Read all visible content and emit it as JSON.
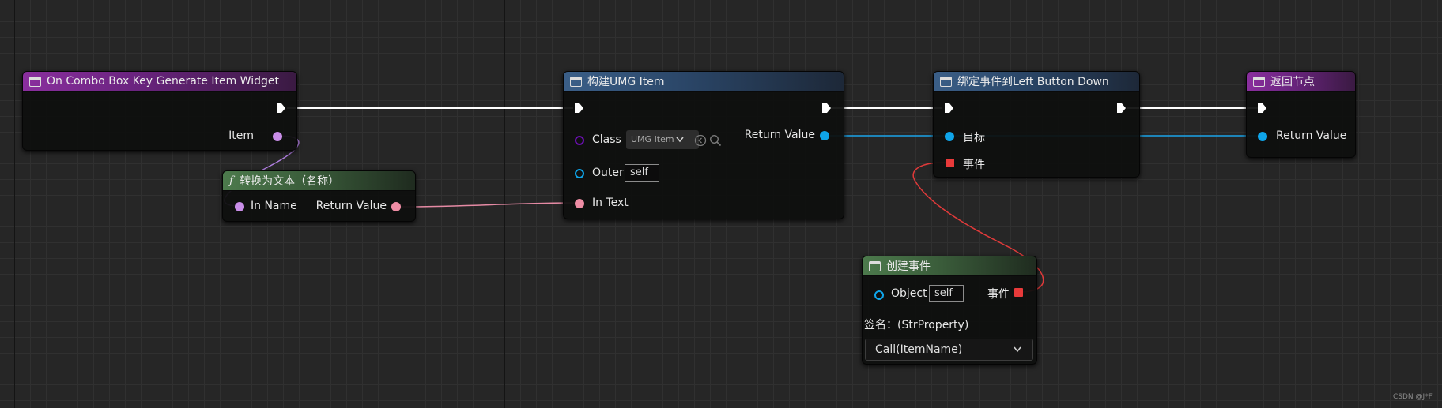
{
  "colors": {
    "exec": "#ffffff",
    "object": "#0fa5ea",
    "class": "#6a0fb0",
    "string": "#e08cc8",
    "text": "#ef8da5",
    "delegate": "#e83a3a",
    "event_header": "#8a2f9e",
    "function_header": "#3b5f88",
    "pure_header": "#4c7a4c"
  },
  "nodes": {
    "on_combo": {
      "title": "On Combo Box Key Generate Item Widget",
      "icon": "function-icon",
      "item_label": "Item"
    },
    "convert": {
      "title": "转换为文本（名称）",
      "icon": "f-function-icon",
      "in_name_label": "In Name",
      "return_label": "Return Value"
    },
    "create_widget": {
      "title": "构建UMG Item",
      "icon": "function-icon",
      "class_label": "Class",
      "class_value": "UMG Item",
      "outer_label": "Outer",
      "outer_value": "self",
      "in_text_label": "In Text",
      "return_label": "Return Value"
    },
    "bind_event": {
      "title": "绑定事件到Left Button Down",
      "icon": "function-icon",
      "target_label": "目标",
      "event_label": "事件"
    },
    "return_node": {
      "title": "返回节点",
      "icon": "function-icon",
      "return_label": "Return Value"
    },
    "create_event": {
      "title": "创建事件",
      "icon": "function-icon",
      "object_label": "Object",
      "object_value": "self",
      "event_label": "事件",
      "signature": "签名：(StrProperty)",
      "selected_function": "Call(ItemName)"
    }
  },
  "watermark": "CSDN @J*F"
}
